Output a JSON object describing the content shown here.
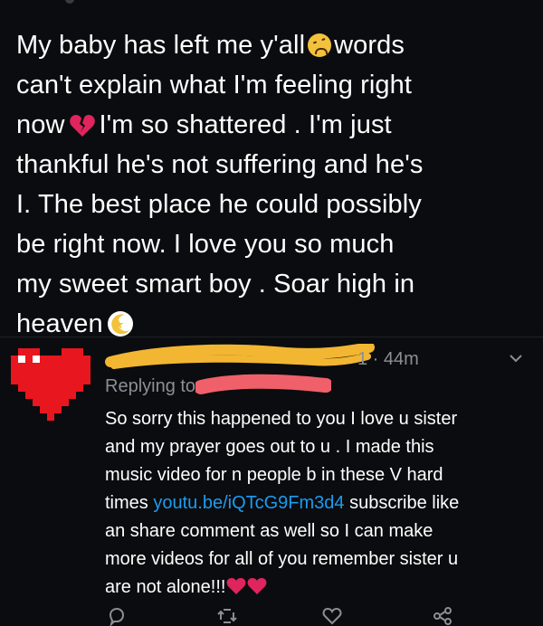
{
  "main_tweet": {
    "line1_a": "My baby has left me y'all",
    "line1_b": "words",
    "line2": "can't explain what I'm feeling right",
    "line3_a": "now",
    "line3_b": "I'm so shattered . I'm just",
    "line4": "thankful he's not suffering and he's",
    "line5": "I. The best place he could possibly",
    "line6": "be right now.  I love you so much",
    "line7": "my sweet smart boy .  Soar high in",
    "line8": "heaven"
  },
  "reply": {
    "time": "1 · 44m",
    "replying_prefix": "Replying to",
    "body_line1": "So sorry this happened to you I love u sister",
    "body_line2": "and my prayer goes out to u . I made this",
    "body_line3": "music video for n people b in these V hard",
    "body_line4_a": "times ",
    "body_line4_link": "youtu.be/iQTcG9Fm3d4",
    "body_line4_b": " subscribe like",
    "body_line5": "an share comment as well so I can make",
    "body_line6": "more videos for all of you remember sister u",
    "body_line7": "are not alone!!!"
  },
  "colors": {
    "background": "#0b0c0f",
    "text": "#ffffff",
    "muted": "#8a8f96",
    "link": "#1d9bf0",
    "heart": "#e0245e",
    "scribble_yellow": "#f2b632",
    "scribble_pink": "#f0606a",
    "avatar_red": "#e8161e"
  },
  "icons": [
    "sad-face-emoji",
    "broken-heart-emoji",
    "moon-star-emoji",
    "red-heart-emoji",
    "chevron-down-icon",
    "reply-icon",
    "retweet-icon",
    "like-icon",
    "share-icon"
  ]
}
